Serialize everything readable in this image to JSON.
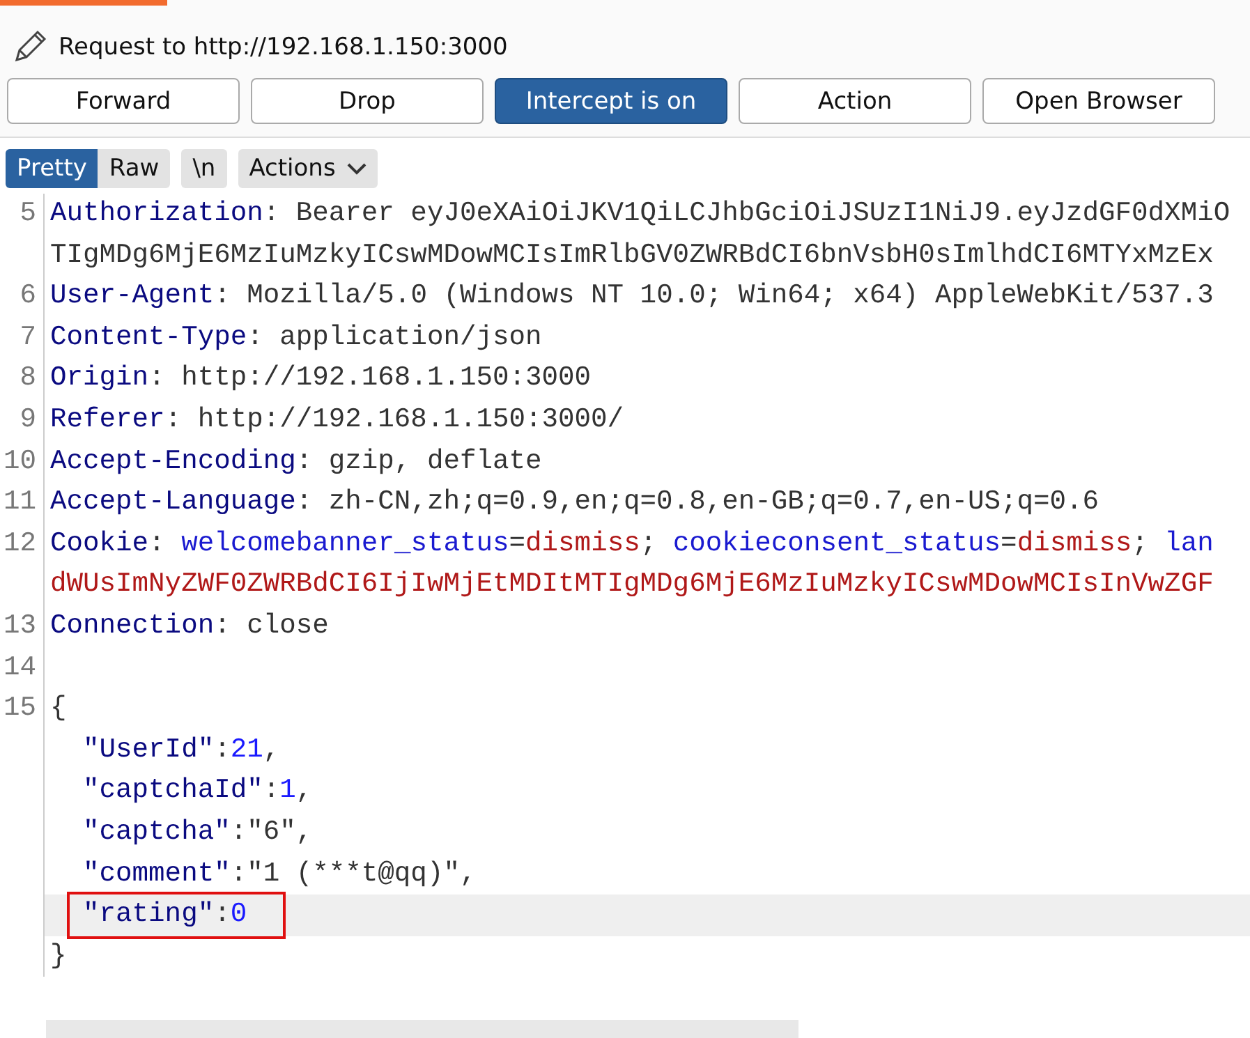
{
  "header": {
    "title": "Request to http://192.168.1.150:3000"
  },
  "buttons": [
    {
      "label": "Forward",
      "selected": false
    },
    {
      "label": "Drop",
      "selected": false
    },
    {
      "label": "Intercept is on",
      "selected": true
    },
    {
      "label": "Action",
      "selected": false
    },
    {
      "label": "Open Browser",
      "selected": false
    }
  ],
  "view_tabs": [
    {
      "label": "Pretty",
      "selected": true
    },
    {
      "label": "Raw",
      "selected": false
    }
  ],
  "newline_toggle": {
    "label": "\\n"
  },
  "actions_menu": {
    "label": "Actions"
  },
  "editor_lines": [
    {
      "number": "5",
      "highlighted": false,
      "boxed": false,
      "segments": [
        {
          "kind": "name",
          "text": "Authorization"
        },
        {
          "kind": "text",
          "text": ": Bearer eyJ0eXAiOiJKV1QiLCJhbGciOiJSUzI1NiJ9.eyJzdGF0dXMiO"
        }
      ]
    },
    {
      "highlighted": false,
      "boxed": false,
      "segments": [
        {
          "kind": "text",
          "text": "TIgMDg6MjE6MzIuMzkyICswMDowMCIsImRlbGV0ZWRBdCI6bnVsbH0sImlhdCI6MTYxMzEx"
        }
      ]
    },
    {
      "number": "6",
      "highlighted": false,
      "boxed": false,
      "segments": [
        {
          "kind": "name",
          "text": "User-Agent"
        },
        {
          "kind": "text",
          "text": ": Mozilla/5.0 (Windows NT 10.0; Win64; x64) AppleWebKit/537.3"
        }
      ]
    },
    {
      "number": "7",
      "highlighted": false,
      "boxed": false,
      "segments": [
        {
          "kind": "name",
          "text": "Content-Type"
        },
        {
          "kind": "text",
          "text": ": application/json"
        }
      ]
    },
    {
      "number": "8",
      "highlighted": false,
      "boxed": false,
      "segments": [
        {
          "kind": "name",
          "text": "Origin"
        },
        {
          "kind": "text",
          "text": ": http://192.168.1.150:3000"
        }
      ]
    },
    {
      "number": "9",
      "highlighted": false,
      "boxed": false,
      "segments": [
        {
          "kind": "name",
          "text": "Referer"
        },
        {
          "kind": "text",
          "text": ": http://192.168.1.150:3000/"
        }
      ]
    },
    {
      "number": "10",
      "highlighted": false,
      "boxed": false,
      "segments": [
        {
          "kind": "name",
          "text": "Accept-Encoding"
        },
        {
          "kind": "text",
          "text": ": gzip, deflate"
        }
      ]
    },
    {
      "number": "11",
      "highlighted": false,
      "boxed": false,
      "segments": [
        {
          "kind": "name",
          "text": "Accept-Language"
        },
        {
          "kind": "text",
          "text": ": zh-CN,zh;q=0.9,en;q=0.8,en-GB;q=0.7,en-US;q=0.6"
        }
      ]
    },
    {
      "number": "12",
      "highlighted": false,
      "boxed": false,
      "segments": [
        {
          "kind": "name",
          "text": "Cookie"
        },
        {
          "kind": "text",
          "text": ": "
        },
        {
          "kind": "cookie-name",
          "text": "welcomebanner_status"
        },
        {
          "kind": "text",
          "text": "="
        },
        {
          "kind": "cookie-value",
          "text": "dismiss"
        },
        {
          "kind": "text",
          "text": "; "
        },
        {
          "kind": "cookie-name",
          "text": "cookieconsent_status"
        },
        {
          "kind": "text",
          "text": "="
        },
        {
          "kind": "cookie-value",
          "text": "dismiss"
        },
        {
          "kind": "text",
          "text": "; "
        },
        {
          "kind": "cookie-name",
          "text": "lan"
        }
      ]
    },
    {
      "highlighted": false,
      "boxed": false,
      "segments": [
        {
          "kind": "cookie-value",
          "text": "dWUsImNyZWF0ZWRBdCI6IjIwMjEtMDItMTIgMDg6MjE6MzIuMzkyICswMDowMCIsInVwZGF"
        }
      ]
    },
    {
      "number": "13",
      "highlighted": false,
      "boxed": false,
      "segments": [
        {
          "kind": "name",
          "text": "Connection"
        },
        {
          "kind": "text",
          "text": ": close"
        }
      ]
    },
    {
      "number": "14",
      "highlighted": false,
      "boxed": false
    },
    {
      "number": "15",
      "highlighted": false,
      "boxed": false,
      "segments": [
        {
          "kind": "text",
          "text": "{"
        }
      ]
    },
    {
      "highlighted": false,
      "boxed": false,
      "segments": [
        {
          "kind": "name",
          "text": "  \"UserId\""
        },
        {
          "kind": "text",
          "text": ":"
        },
        {
          "kind": "number",
          "text": "21"
        },
        {
          "kind": "text",
          "text": ","
        }
      ]
    },
    {
      "highlighted": false,
      "boxed": false,
      "segments": [
        {
          "kind": "name",
          "text": "  \"captchaId\""
        },
        {
          "kind": "text",
          "text": ":"
        },
        {
          "kind": "number",
          "text": "1"
        },
        {
          "kind": "text",
          "text": ","
        }
      ]
    },
    {
      "highlighted": false,
      "boxed": false,
      "segments": [
        {
          "kind": "name",
          "text": "  \"captcha\""
        },
        {
          "kind": "text",
          "text": ":\"6\","
        }
      ]
    },
    {
      "highlighted": false,
      "boxed": false,
      "segments": [
        {
          "kind": "name",
          "text": "  \"comment\""
        },
        {
          "kind": "text",
          "text": ":\"1 (***t@qq)\","
        }
      ]
    },
    {
      "highlighted": true,
      "boxed": true,
      "segments": [
        {
          "kind": "name",
          "text": "  \"rating\""
        },
        {
          "kind": "text",
          "text": ":"
        },
        {
          "kind": "number",
          "text": "0"
        }
      ]
    },
    {
      "highlighted": false,
      "boxed": false,
      "segments": [
        {
          "kind": "text",
          "text": "}"
        }
      ]
    }
  ]
}
